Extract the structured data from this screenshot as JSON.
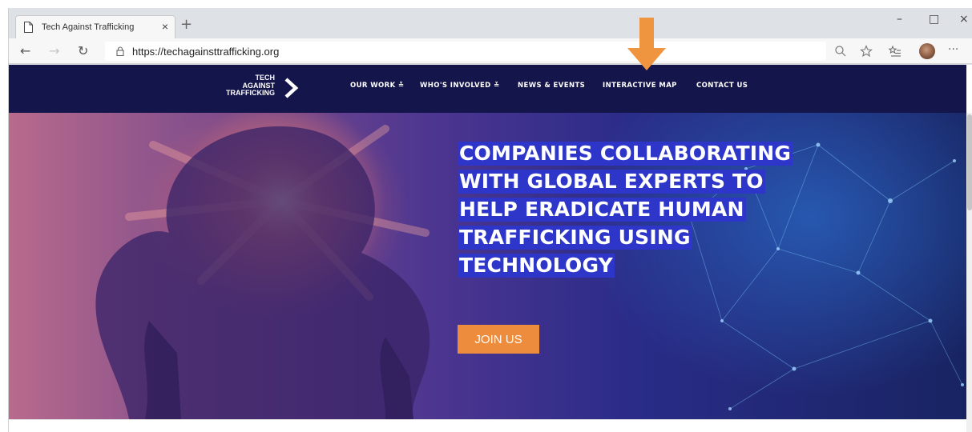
{
  "browser": {
    "tab_title": "Tech Against Trafficking",
    "tab_close": "×",
    "new_tab": "+",
    "url": "https://techagainsttrafficking.org",
    "back": "←",
    "forward": "→",
    "refresh": "↻",
    "more": "···",
    "minimize": "–",
    "maximize": "□",
    "close": "×"
  },
  "site": {
    "logo": {
      "line1": "TECH",
      "line2": "AGAINST",
      "line3": "TRAFFICKING"
    },
    "nav": [
      {
        "label": "OUR WORK ≚"
      },
      {
        "label": "WHO'S INVOLVED ≚"
      },
      {
        "label": "NEWS & EVENTS"
      },
      {
        "label": "INTERACTIVE MAP"
      },
      {
        "label": "CONTACT US"
      }
    ],
    "hero": {
      "headline_lines": [
        "COMPANIES COLLABORATING",
        "WITH GLOBAL EXPERTS TO",
        "HELP ERADICATE HUMAN",
        "TRAFFICKING USING",
        "TECHNOLOGY"
      ],
      "cta_label": "JOIN US"
    }
  },
  "colors": {
    "nav_bg": "#14154a",
    "headline_highlight": "#2d36c9",
    "cta_bg": "#ee8c3e",
    "annotation_arrow": "#f0953f"
  },
  "icons": [
    "page-icon",
    "lock-icon",
    "zoom-icon",
    "star-icon",
    "favorites-icon",
    "profile-icon",
    "logo-chevron-icon",
    "annotation-arrow-icon"
  ]
}
